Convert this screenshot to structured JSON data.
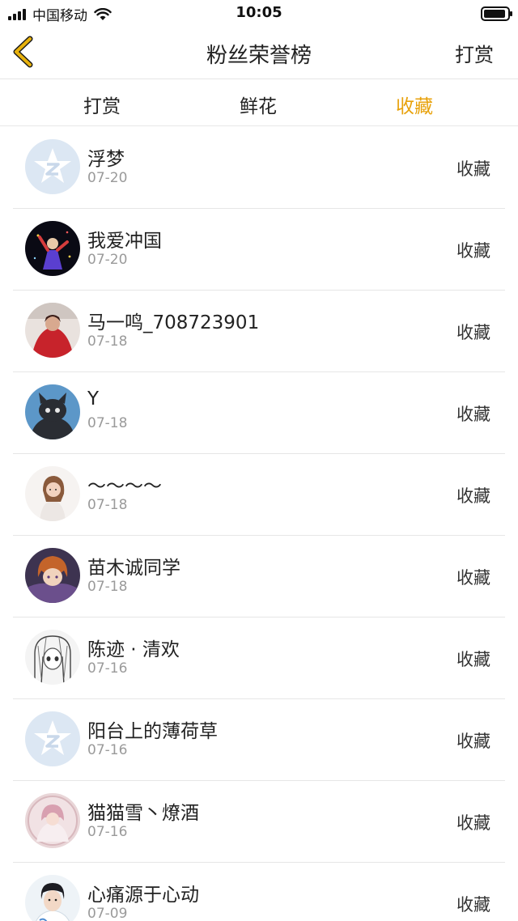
{
  "status_bar": {
    "carrier": "中国移动",
    "time": "10:05"
  },
  "header": {
    "title": "粉丝荣誉榜",
    "right_action": "打赏"
  },
  "tabs": [
    {
      "label": "打赏",
      "active": false
    },
    {
      "label": "鲜花",
      "active": false
    },
    {
      "label": "收藏",
      "active": true
    }
  ],
  "colors": {
    "accent": "#e8a20c",
    "back_arrow": "#e8b20c",
    "text_primary": "#222222",
    "text_secondary": "#9a9a9a",
    "divider": "#e6e6e6"
  },
  "list": [
    {
      "name": "浮梦",
      "date": "07-20",
      "action": "收藏",
      "avatar": "default-star-avatar"
    },
    {
      "name": "我爱冲国",
      "date": "07-20",
      "action": "收藏",
      "avatar": "dark-figure-avatar"
    },
    {
      "name": "马一鸣_708723901",
      "date": "07-18",
      "action": "收藏",
      "avatar": "red-dress-avatar"
    },
    {
      "name": "Y",
      "date": "07-18",
      "action": "收藏",
      "avatar": "black-cat-avatar"
    },
    {
      "name": "～～～～",
      "date": "07-18",
      "action": "收藏",
      "avatar": "girl-white-avatar"
    },
    {
      "name": "苗木诚同学",
      "date": "07-18",
      "action": "收藏",
      "avatar": "anime-boy-avatar"
    },
    {
      "name": "陈迹 · 清欢",
      "date": "07-16",
      "action": "收藏",
      "avatar": "sketch-girl-avatar"
    },
    {
      "name": "阳台上的薄荷草",
      "date": "07-16",
      "action": "收藏",
      "avatar": "default-star-avatar"
    },
    {
      "name": "猫猫雪丶燎酒",
      "date": "07-16",
      "action": "收藏",
      "avatar": "pink-girl-avatar"
    },
    {
      "name": "心痛源于心动",
      "date": "07-09",
      "action": "收藏",
      "avatar": "boy-portrait-avatar"
    }
  ]
}
